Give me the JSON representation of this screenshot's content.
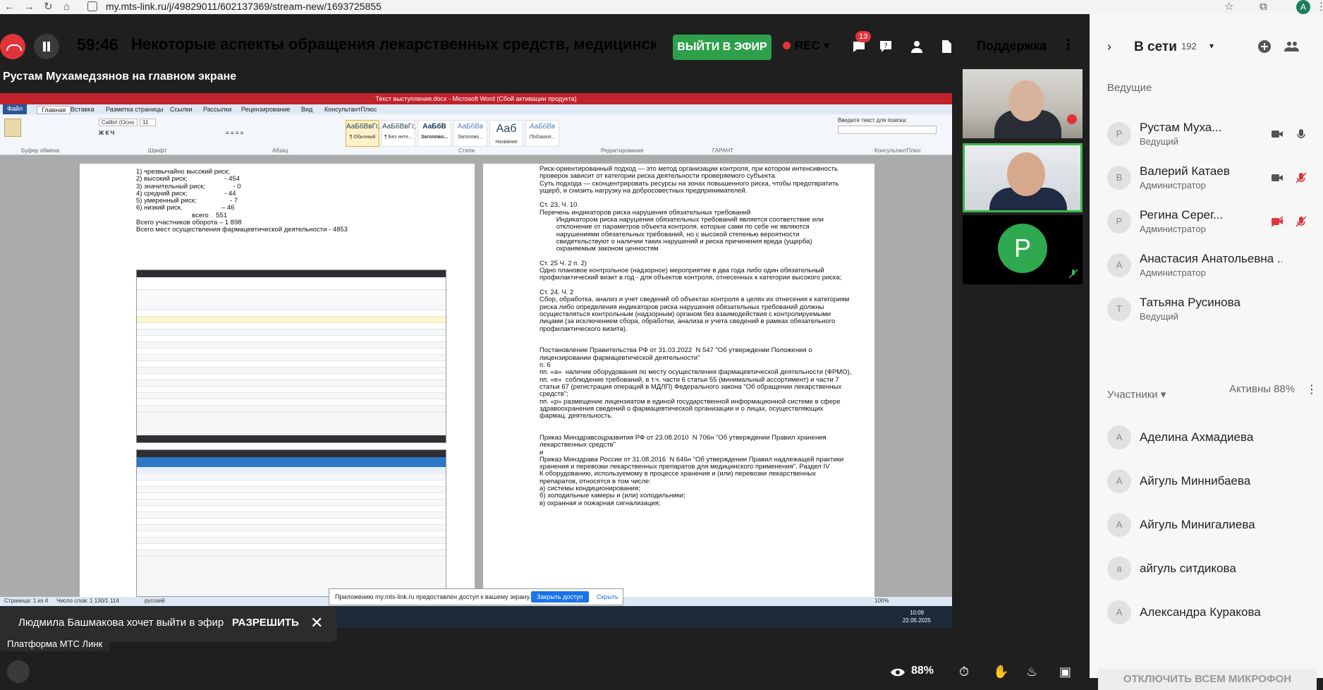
{
  "browser": {
    "url": "my.mts-link.ru/j/49829011/602137369/stream-new/1693725855",
    "avatar": "A"
  },
  "header": {
    "timer": "59:46",
    "title": "Некоторые аспекты обращения лекарственных средств, медицинских издел",
    "live_label": "ВЫЙТИ В ЭФИР",
    "rec_label": "REC",
    "chat_badge": "13",
    "support_label": "Поддержка"
  },
  "stage": {
    "share_label": "Рустам Мухамедзянов на главном экране"
  },
  "word": {
    "title": "Текст выступления.docx - Microsoft Word (Сбой активации продукта)",
    "tabs": [
      "Файл",
      "Главная",
      "Вставка",
      "Разметка страницы",
      "Ссылки",
      "Рассылки",
      "Рецензирование",
      "Вид",
      "КонсультантПлюс"
    ],
    "groups": [
      "Буфер обмена",
      "Шрифт",
      "Абзац",
      "Стили",
      "Редактирование",
      "ГАРАНТ",
      "КонсультантПлюс"
    ],
    "font_name": "Calibri (Осно",
    "font_size": "11",
    "styles": [
      {
        "sample": "АаБбВвГг,",
        "name": "¶ Обычный"
      },
      {
        "sample": "АаБбВвГг,",
        "name": "¶ Без инте..."
      },
      {
        "sample": "АаБбВ",
        "name": "Заголово..."
      },
      {
        "sample": "АаБбВв",
        "name": "Заголово..."
      },
      {
        "sample": "Ааб",
        "name": "Название"
      },
      {
        "sample": "АаБбВв",
        "name": "Подзагол..."
      }
    ],
    "search_placeholder": "Введите текст для поиска:",
    "page1_lines": [
      "1) чрезвычайно высокий риск;",
      "2) высокий риск;                    - 454",
      "3) значительный риск;               - 0",
      "4) средний риск;                    - 44",
      "5) умеренный риск;                  - 7",
      "6) низкий риск.                     – 46",
      "                              всего    551",
      "Всего участников оборота – 1 898",
      "Всего мест осуществления фармацевтической деятельности - 4853"
    ],
    "page2_lines": [
      "Риск-ориентированный подход — это метод организации контроля, при котором интенсивность",
      "проверок зависит от категории риска деятельности проверяемого субъекта.",
      "Суть подхода — сконцентрировать ресурсы на зонах повышенного риска, чтобы предотвратить",
      "ущерб, и снизить нагрузку на добросовестных предпринимателей.",
      "",
      "Ст. 23, Ч. 10.",
      "Перечень индикаторов риска нарушения обязательных требований",
      "         Индикатором риска нарушения обязательных требований является соответствие или",
      "         отклонение от параметров объекта контроля, которые сами по себе не являются",
      "         нарушениями обязательных требований, но с высокой степенью вероятности",
      "         свидетельствуют о наличии таких нарушений и риска причинения вреда (ущерба)",
      "         охраняемым законом ценностям",
      "",
      "Ст. 25 Ч. 2 п. 2)",
      "Одно плановое контрольное (надзорное) мероприятие в два года либо один обязательный",
      "профилактический визит в год - для объектов контроля, отнесенных к категории высокого риска;",
      "",
      "Ст. 24. Ч. 2",
      "Сбор, обработка, анализ и учет сведений об объектах контроля в целях их отнесения к категориям",
      "риска либо определения индикаторов риска нарушения обязательных требований должны",
      "осуществляться контрольным (надзорным) органом без взаимодействия с контролируемыми",
      "лицами (за исключением сбора, обработки, анализа и учета сведений в рамках обязательного",
      "профилактического визита).",
      "",
      "",
      "Постановление Правительства РФ от 31.03.2022  N 547 \"Об утверждении Положения о",
      "лицензировании фармацевтической деятельности\"",
      "п. 6",
      "пп. «а»  наличие оборудования по месту осуществления фармацевтической деятельности (ФРМО),",
      "пп. «е»  соблюдение требований, в т.ч. части 6 статьи 55 (минимальный ассортимент) и части 7",
      "статьи 67 (регистрация операций в МДЛП) Федерального закона \"Об обращении лекарственных",
      "средств\";",
      "пп. «р» размещение лицензиатом в единой государственной информационной системе в сфере",
      "здравоохранения сведений о фармацевтической организации и о лицах, осуществляющих",
      "фармац. деятельность.",
      "",
      "",
      "Приказ Минздравсоцразвития РФ от 23.08.2010  N 706н \"Об утверждении Правил хранения",
      "лекарственных средств\"",
      "и",
      "Приказ Минздрава России от 31.08.2016  N 646н \"Об утверждении Правил надлежащей практики",
      "хранения и перевозки лекарственных препаратов для медицинского применения\". Раздел IV",
      "К оборудованию, используемому в процессе хранения и (или) перевозки лекарственных",
      "препаратов, относятся в том числе:",
      "а) системы кондиционирования;",
      "б) холодильные камеры и (или) холодильники;",
      "в) охранная и пожарная сигнализация;"
    ],
    "status_page": "Страница: 1 из 4",
    "status_words": "Число слов: 1 130/1 114",
    "status_lang": "русский",
    "zoom": "100%",
    "clock_time": "10:09",
    "clock_date": "22.05.2025",
    "toast_text": "Приложению my.mts-link.ru предоставлен доступ к вашему экрану.",
    "toast_button": "Закрыть доступ",
    "toast_hide": "Скрыть"
  },
  "thumbs": [
    {
      "letter": "P"
    }
  ],
  "right_panel": {
    "online_label": "В сети",
    "online_count": "192",
    "hosts_label": "Ведущие",
    "hosts": [
      {
        "initial": "Р",
        "name": "Рустам Муха...",
        "role": "Ведущий"
      },
      {
        "initial": "В",
        "name": "Валерий Катаев",
        "role": "Администратор"
      },
      {
        "initial": "Р",
        "name": "Регина Серег...",
        "role": "Администратор"
      },
      {
        "initial": "А",
        "name": "Анастасия Анатольевна ...",
        "role": "Администратор"
      },
      {
        "initial": "Т",
        "name": "Татьяна Русинова",
        "role": "Ведущий"
      }
    ],
    "participants_label": "Участники",
    "active_label": "Активны 88%",
    "participants": [
      {
        "initial": "А",
        "name": "Аделина Ахмадиева"
      },
      {
        "initial": "А",
        "name": "Айгуль Миннибаева"
      },
      {
        "initial": "А",
        "name": "Айгуль Минигалиева"
      },
      {
        "initial": "а",
        "name": "айгуль ситдикова"
      },
      {
        "initial": "А",
        "name": "Александра Куракова"
      }
    ],
    "mute_all": "ОТКЛЮЧИТЬ ВСЕМ МИКРОФОН"
  },
  "bottom": {
    "request_text": "Людмила Башмакова хочет выйти в эфир",
    "allow_label": "РАЗРЕШИТЬ",
    "platform_label": "Платформа МТС Линк",
    "views": "88%"
  }
}
